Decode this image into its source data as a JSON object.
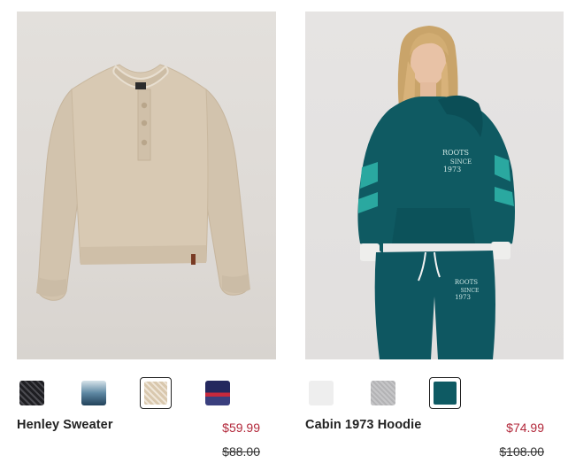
{
  "products": [
    {
      "name": "Henley Sweater",
      "price": "$59.99",
      "original_price": "$88.00",
      "image": "beige-henley-sweater",
      "swatches": [
        {
          "color": "#2a2a2e",
          "pattern": "dark-knit",
          "selected": false
        },
        {
          "color": "#3a5a72",
          "pattern": "blue-fade",
          "selected": false
        },
        {
          "color": "#d6c7b0",
          "pattern": "beige-knit",
          "selected": true
        },
        {
          "color": "#2c2f6a",
          "pattern": "navy-red",
          "selected": false
        }
      ]
    },
    {
      "name": "Cabin 1973 Hoodie",
      "price": "$74.99",
      "original_price": "$108.00",
      "image": "teal-hoodie-model",
      "swatches": [
        {
          "color": "#eeeeee",
          "pattern": "light-grey",
          "selected": false
        },
        {
          "color": "#b9b9bb",
          "pattern": "heather-grey",
          "selected": false
        },
        {
          "color": "#0e5a63",
          "pattern": "teal",
          "selected": true
        }
      ]
    }
  ],
  "colors": {
    "sale_price": "#b32a3c",
    "text": "#222222",
    "selected_border": "#222222"
  }
}
